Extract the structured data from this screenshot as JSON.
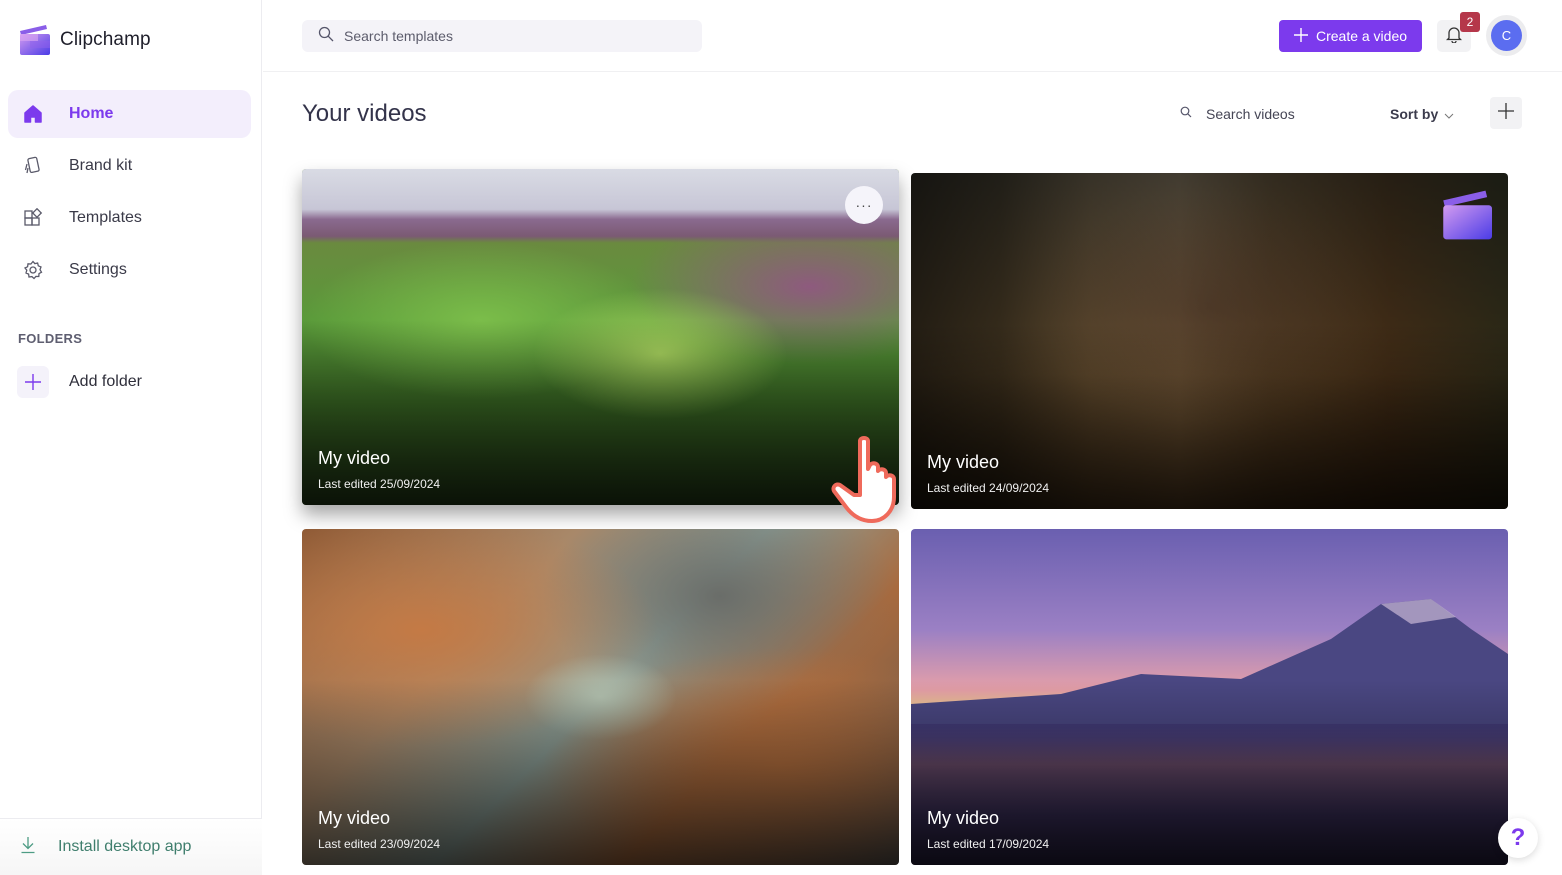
{
  "app": {
    "name": "Clipchamp"
  },
  "sidebar": {
    "items": [
      {
        "label": "Home",
        "icon": "home-icon",
        "active": true
      },
      {
        "label": "Brand kit",
        "icon": "brand-kit-icon",
        "active": false
      },
      {
        "label": "Templates",
        "icon": "templates-icon",
        "active": false
      },
      {
        "label": "Settings",
        "icon": "gear-icon",
        "active": false
      }
    ],
    "folders_title": "FOLDERS",
    "add_folder_label": "Add folder",
    "install_label": "Install desktop app"
  },
  "topbar": {
    "search_placeholder": "Search templates",
    "create_label": "Create a video",
    "notification_count": "2",
    "avatar_initial": "C"
  },
  "main": {
    "title": "Your videos",
    "search_placeholder": "Search videos",
    "sort_label": "Sort by",
    "videos": [
      {
        "title": "My video",
        "date": "Last edited 25/09/2024",
        "thumbnail": "aerial green fields"
      },
      {
        "title": "My video",
        "date": "Last edited 24/09/2024",
        "thumbnail": "group of people on stairs"
      },
      {
        "title": "My video",
        "date": "Last edited 23/09/2024",
        "thumbnail": "aerial river delta"
      },
      {
        "title": "My video",
        "date": "Last edited 17/09/2024",
        "thumbnail": "mountain at sunset over lake"
      }
    ],
    "more_label": "···"
  },
  "help": {
    "label": "?"
  },
  "colors": {
    "accent": "#7c3aed",
    "badge": "#b5374a",
    "avatar": "#5b6df0",
    "install_text": "#3f7e6d"
  }
}
